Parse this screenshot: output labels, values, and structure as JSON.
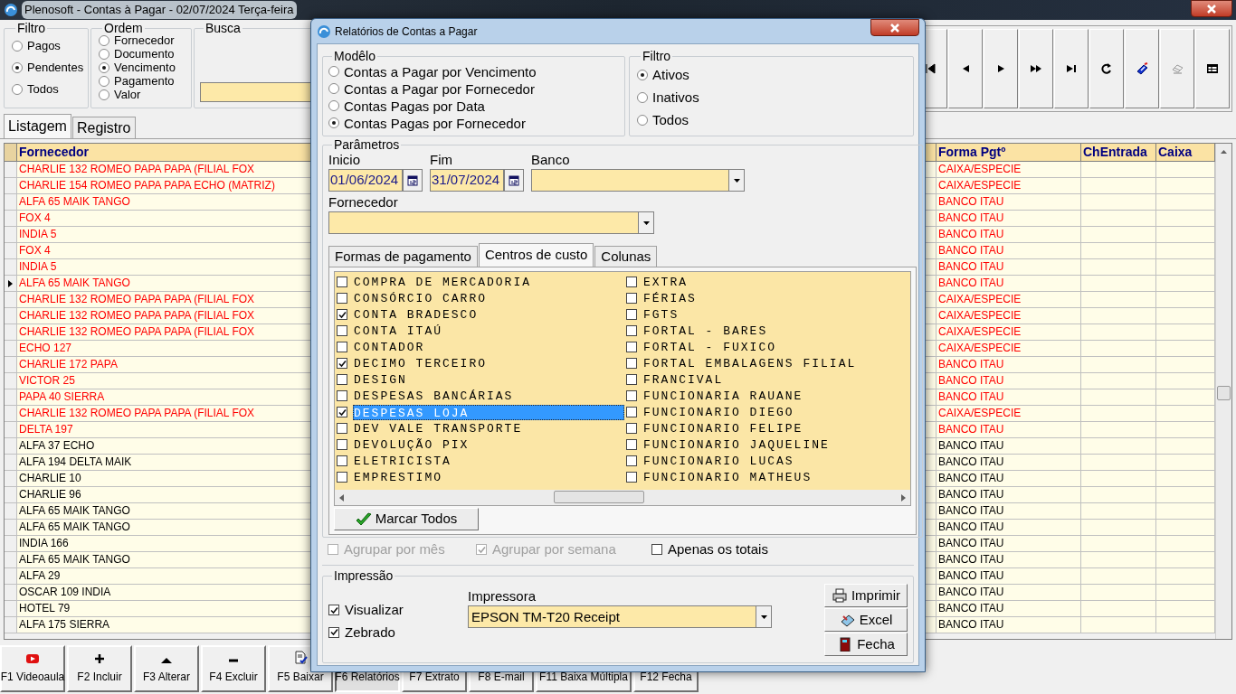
{
  "window": {
    "title": "Plenosoft - Contas à Pagar - 02/07/2024 Terça-feira"
  },
  "filtro": {
    "label": "Filtro",
    "options": [
      {
        "label": "Pagos",
        "selected": false
      },
      {
        "label": "Pendentes",
        "selected": true
      },
      {
        "label": "Todos",
        "selected": false
      }
    ]
  },
  "ordem": {
    "label": "Ordem",
    "options": [
      {
        "label": "Fornecedor",
        "selected": false
      },
      {
        "label": "Documento",
        "selected": false
      },
      {
        "label": "Vencimento",
        "selected": true
      },
      {
        "label": "Pagamento",
        "selected": false
      },
      {
        "label": "Valor",
        "selected": false
      }
    ]
  },
  "busca": {
    "label": "Busca"
  },
  "tabs": [
    {
      "label": "Listagem",
      "selected": true
    },
    {
      "label": "Registro",
      "selected": false
    }
  ],
  "table": {
    "columns": [
      "Fornecedor",
      "Forma Pgtº",
      "ChEntrada",
      "Caixa"
    ],
    "rows": [
      {
        "fornecedor": "CHARLIE 132 ROMEO PAPA PAPA (FILIAL FOX",
        "forma_pgt": "CAIXA/ESPECIE",
        "color": "#ff0000",
        "selected": false
      },
      {
        "fornecedor": "CHARLIE 154 ROMEO PAPA PAPA ECHO (MATRIZ)",
        "forma_pgt": "CAIXA/ESPECIE",
        "color": "#ff0000",
        "selected": false
      },
      {
        "fornecedor": "ALFA 65 MAIK TANGO",
        "forma_pgt": "BANCO ITAU",
        "color": "#ff0000",
        "selected": false
      },
      {
        "fornecedor": "FOX 4",
        "forma_pgt": "BANCO ITAU",
        "color": "#ff0000",
        "selected": false
      },
      {
        "fornecedor": "INDIA 5",
        "forma_pgt": "BANCO ITAU",
        "color": "#ff0000",
        "selected": false
      },
      {
        "fornecedor": "FOX 4",
        "forma_pgt": "BANCO ITAU",
        "color": "#ff0000",
        "selected": false
      },
      {
        "fornecedor": "INDIA 5",
        "forma_pgt": "BANCO ITAU",
        "color": "#ff0000",
        "selected": false
      },
      {
        "fornecedor": "ALFA 65 MAIK TANGO",
        "forma_pgt": "BANCO ITAU",
        "color": "#ff0000",
        "selected": true
      },
      {
        "fornecedor": "CHARLIE 132 ROMEO PAPA PAPA (FILIAL FOX",
        "forma_pgt": "CAIXA/ESPECIE",
        "color": "#ff0000",
        "selected": false
      },
      {
        "fornecedor": "CHARLIE 132 ROMEO PAPA PAPA (FILIAL FOX",
        "forma_pgt": "CAIXA/ESPECIE",
        "color": "#ff0000",
        "selected": false
      },
      {
        "fornecedor": "CHARLIE 132 ROMEO PAPA PAPA (FILIAL FOX",
        "forma_pgt": "CAIXA/ESPECIE",
        "color": "#ff0000",
        "selected": false
      },
      {
        "fornecedor": "ECHO 127",
        "forma_pgt": "CAIXA/ESPECIE",
        "color": "#ff0000",
        "selected": false
      },
      {
        "fornecedor": "CHARLIE 172 PAPA",
        "forma_pgt": "BANCO ITAU",
        "color": "#ff0000",
        "selected": false
      },
      {
        "fornecedor": "VICTOR 25",
        "forma_pgt": "BANCO ITAU",
        "color": "#ff0000",
        "selected": false
      },
      {
        "fornecedor": "PAPA 40 SIERRA",
        "forma_pgt": "BANCO ITAU",
        "color": "#ff0000",
        "selected": false
      },
      {
        "fornecedor": "CHARLIE 132 ROMEO PAPA PAPA (FILIAL FOX",
        "forma_pgt": "CAIXA/ESPECIE",
        "color": "#ff0000",
        "selected": false
      },
      {
        "fornecedor": "DELTA 197",
        "forma_pgt": "BANCO ITAU",
        "color": "#ff0000",
        "selected": false
      },
      {
        "fornecedor": "ALFA 37 ECHO",
        "forma_pgt": "BANCO ITAU",
        "color": "#000000",
        "selected": false
      },
      {
        "fornecedor": "ALFA 194 DELTA MAIK",
        "forma_pgt": "BANCO ITAU",
        "color": "#000000",
        "selected": false
      },
      {
        "fornecedor": "CHARLIE 10",
        "forma_pgt": "BANCO ITAU",
        "color": "#000000",
        "selected": false
      },
      {
        "fornecedor": "CHARLIE 96",
        "forma_pgt": "BANCO ITAU",
        "color": "#000000",
        "selected": false
      },
      {
        "fornecedor": "ALFA 65 MAIK TANGO",
        "forma_pgt": "BANCO ITAU",
        "color": "#000000",
        "selected": false
      },
      {
        "fornecedor": "ALFA 65 MAIK TANGO",
        "forma_pgt": "BANCO ITAU",
        "color": "#000000",
        "selected": false
      },
      {
        "fornecedor": "INDIA 166",
        "forma_pgt": "BANCO ITAU",
        "color": "#000000",
        "selected": false
      },
      {
        "fornecedor": "ALFA 65 MAIK TANGO",
        "forma_pgt": "BANCO ITAU",
        "color": "#000000",
        "selected": false
      },
      {
        "fornecedor": "ALFA 29",
        "forma_pgt": "BANCO ITAU",
        "color": "#000000",
        "selected": false
      },
      {
        "fornecedor": "OSCAR 109 INDIA",
        "forma_pgt": "BANCO ITAU",
        "color": "#000000",
        "selected": false
      },
      {
        "fornecedor": "HOTEL 79",
        "forma_pgt": "BANCO ITAU",
        "color": "#000000",
        "selected": false
      },
      {
        "fornecedor": "ALFA 175 SIERRA",
        "forma_pgt": "BANCO ITAU",
        "color": "#000000",
        "selected": false
      }
    ]
  },
  "function_keys": [
    {
      "label": "F1 Videoaula",
      "kind": "video",
      "selected": false
    },
    {
      "label": "F2 Incluir",
      "kind": "plus",
      "selected": false
    },
    {
      "label": "F3 Alterar",
      "kind": "up",
      "selected": false
    },
    {
      "label": "F4 Excluir",
      "kind": "minus",
      "selected": false
    },
    {
      "label": "F5 Baixar",
      "kind": "document",
      "selected": false
    },
    {
      "label": "F6 Relatórios",
      "kind": "text",
      "selected": true
    },
    {
      "label": "F7 Extrato",
      "kind": "text",
      "selected": false
    },
    {
      "label": "F8 E-mail",
      "kind": "text",
      "selected": false
    },
    {
      "label": "F11 Baixa Múltipla",
      "kind": "text",
      "selected": false
    },
    {
      "label": "F12 Fecha",
      "kind": "text",
      "selected": false
    }
  ],
  "dialog": {
    "title": "Relatórios de Contas a Pagar",
    "modelo": {
      "label": "Modêlo",
      "options": [
        {
          "label": "Contas a Pagar por Vencimento",
          "selected": false
        },
        {
          "label": "Contas a Pagar por Fornecedor",
          "selected": false
        },
        {
          "label": "Contas Pagas por Data",
          "selected": false
        },
        {
          "label": "Contas Pagas por Fornecedor",
          "selected": true
        }
      ]
    },
    "filtro": {
      "label": "Filtro",
      "options": [
        {
          "label": "Ativos",
          "selected": true
        },
        {
          "label": "Inativos",
          "selected": false
        },
        {
          "label": "Todos",
          "selected": false
        }
      ]
    },
    "parametros": {
      "label": "Parâmetros",
      "inicio": {
        "label": "Inicio",
        "value": "01/06/2024"
      },
      "fim": {
        "label": "Fim",
        "value": "31/07/2024"
      },
      "banco": {
        "label": "Banco"
      },
      "fornecedor": {
        "label": "Fornecedor"
      }
    },
    "tabs": [
      {
        "label": "Formas de pagamento",
        "selected": false
      },
      {
        "label": "Centros de custo",
        "selected": true
      },
      {
        "label": "Colunas",
        "selected": false
      }
    ],
    "centros_de_custo": [
      {
        "label": "COMPRA DE MERCADORIA",
        "checked": false,
        "selected": false
      },
      {
        "label": "CONSÓRCIO CARRO",
        "checked": false,
        "selected": false
      },
      {
        "label": "CONTA BRADESCO",
        "checked": true,
        "selected": false
      },
      {
        "label": "CONTA ITAÚ",
        "checked": false,
        "selected": false
      },
      {
        "label": "CONTADOR",
        "checked": false,
        "selected": false
      },
      {
        "label": "DECIMO TERCEIRO",
        "checked": true,
        "selected": false
      },
      {
        "label": "DESIGN",
        "checked": false,
        "selected": false
      },
      {
        "label": "DESPESAS BANCÁRIAS",
        "checked": false,
        "selected": false
      },
      {
        "label": "DESPESAS LOJA",
        "checked": true,
        "selected": true
      },
      {
        "label": "DEV VALE TRANSPORTE",
        "checked": false,
        "selected": false
      },
      {
        "label": "DEVOLUÇÃO PIX",
        "checked": false,
        "selected": false
      },
      {
        "label": "ELETRICISTA",
        "checked": false,
        "selected": false
      },
      {
        "label": "EMPRESTIMO",
        "checked": false,
        "selected": false
      },
      {
        "label": "EXTRA",
        "checked": false,
        "selected": false
      },
      {
        "label": "FÉRIAS",
        "checked": false,
        "selected": false
      },
      {
        "label": "FGTS",
        "checked": false,
        "selected": false
      },
      {
        "label": "FORTAL - BARES",
        "checked": false,
        "selected": false
      },
      {
        "label": "FORTAL - FUXICO",
        "checked": false,
        "selected": false
      },
      {
        "label": "FORTAL EMBALAGENS FILIAL",
        "checked": false,
        "selected": false
      },
      {
        "label": "FRANCIVAL",
        "checked": false,
        "selected": false
      },
      {
        "label": "FUNCIONARIA RAUANE",
        "checked": false,
        "selected": false
      },
      {
        "label": "FUNCIONARIO DIEGO",
        "checked": false,
        "selected": false
      },
      {
        "label": "FUNCIONARIO FELIPE",
        "checked": false,
        "selected": false
      },
      {
        "label": "FUNCIONARIO JAQUELINE",
        "checked": false,
        "selected": false
      },
      {
        "label": "FUNCIONARIO LUCAS",
        "checked": false,
        "selected": false
      },
      {
        "label": "FUNCIONARIO MATHEUS",
        "checked": false,
        "selected": false
      }
    ],
    "marcar_todos": "Marcar Todos",
    "options": [
      {
        "label": "Agrupar por mês",
        "checked": false,
        "disabled": true
      },
      {
        "label": "Agrupar por semana",
        "checked": true,
        "disabled": true
      },
      {
        "label": "Apenas os totais",
        "checked": false,
        "disabled": false
      }
    ],
    "impressao": {
      "label": "Impressão",
      "options": [
        {
          "label": "Visualizar",
          "checked": true
        },
        {
          "label": "Zebrado",
          "checked": true
        }
      ],
      "impressora": {
        "label": "Impressora",
        "value": "EPSON TM-T20 Receipt"
      },
      "buttons": [
        {
          "label": "Imprimir",
          "kind": "print"
        },
        {
          "label": "Excel",
          "kind": "excel"
        },
        {
          "label": "Fecha",
          "kind": "close"
        }
      ]
    }
  }
}
